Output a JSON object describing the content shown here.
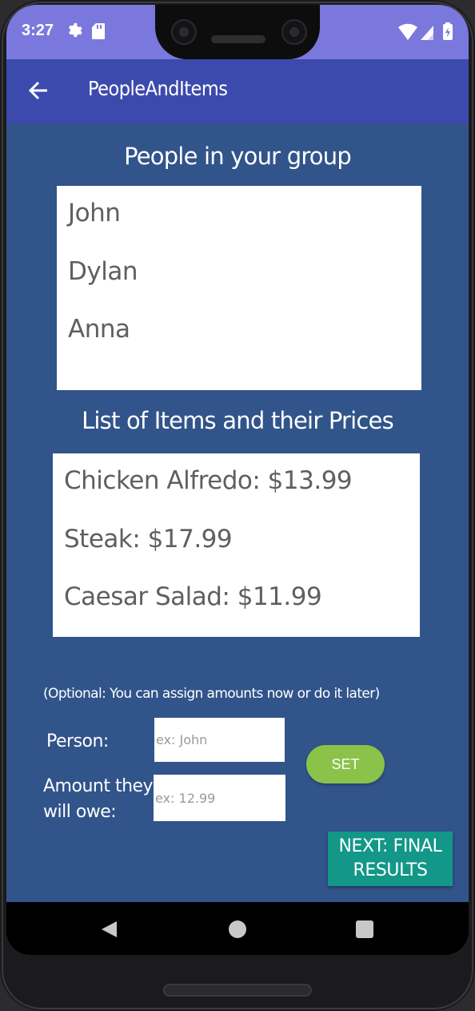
{
  "status_bar": {
    "time": "3:27",
    "icons": [
      "gear-icon",
      "sd-card-icon",
      "wifi-icon",
      "cell-signal-icon",
      "battery-icon"
    ]
  },
  "app_bar": {
    "title": "PeopleAndItems",
    "back_icon": "arrow-left-icon"
  },
  "people_section": {
    "heading": "People in your group",
    "people": [
      "John",
      "Dylan",
      "Anna"
    ]
  },
  "items_section": {
    "heading": "List of Items and their Prices",
    "items": [
      "Chicken Alfredo: $13.99",
      "Steak: $17.99",
      "Caesar Salad: $11.99"
    ]
  },
  "assign_form": {
    "note": "(Optional: You can assign amounts now or do it later)",
    "person_label": "Person:",
    "person_placeholder": "ex: John",
    "amount_label_line1": "Amount they",
    "amount_label_line2": "will owe:",
    "amount_placeholder": "ex: 12.99",
    "set_label": "SET"
  },
  "next_button": {
    "line1": "NEXT: FINAL",
    "line2": "RESULTS"
  },
  "colors": {
    "status_bar": "#7a78dc",
    "app_bar": "#3c4aae",
    "background": "#31548a",
    "set_button": "#8bc24a",
    "next_button": "#129788"
  },
  "nav_bar": {
    "icons": [
      "back-triangle-icon",
      "home-circle-icon",
      "recents-square-icon"
    ]
  }
}
